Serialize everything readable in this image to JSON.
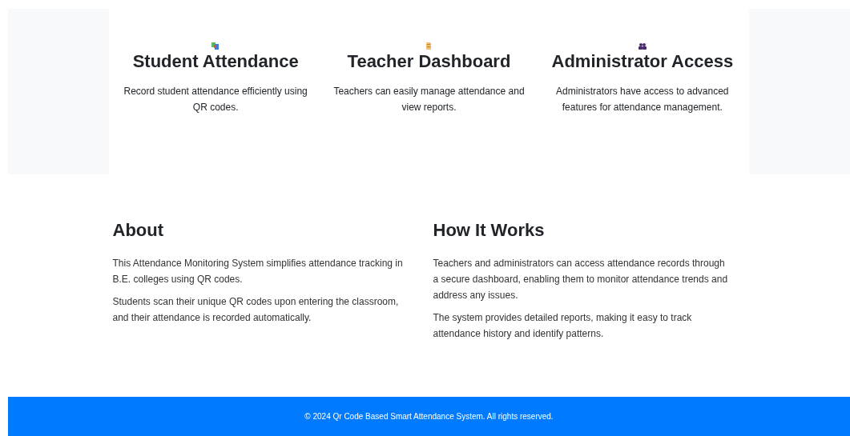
{
  "features": [
    {
      "title": "Student Attendance",
      "text": "Record student attendance efficiently using QR codes."
    },
    {
      "title": "Teacher Dashboard",
      "text": "Teachers can easily manage attendance and view reports."
    },
    {
      "title": "Administrator Access",
      "text": "Administrators have access to advanced features for attendance management."
    }
  ],
  "sections": [
    {
      "title": "About",
      "paragraphs": [
        "This Attendance Monitoring System simplifies attendance tracking in B.E. colleges using QR codes.",
        "Students scan their unique QR codes upon entering the classroom, and their attendance is recorded automatically."
      ]
    },
    {
      "title": "How It Works",
      "paragraphs": [
        "Teachers and administrators can access attendance records through a secure dashboard, enabling them to monitor attendance trends and address any issues.",
        "The system provides detailed reports, making it easy to track attendance history and identify patterns."
      ]
    }
  ],
  "footer": "© 2024 Qr Code Based Smart Attendance System. All rights reserved."
}
